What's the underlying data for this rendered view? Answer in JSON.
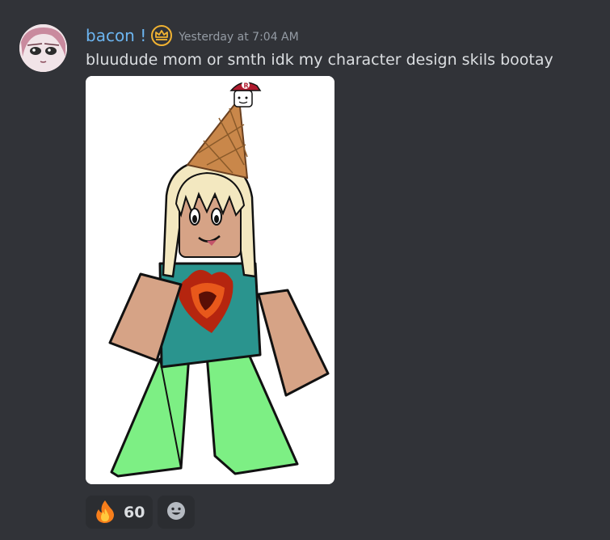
{
  "message": {
    "author": {
      "username": "bacon !",
      "avatar_icon": "anime-avatar-icon",
      "role_icon": "crown-badge-icon",
      "username_color": "#6cb5f0"
    },
    "timestamp": "Yesterday at 7:04 AM",
    "content": "bluudude mom or smth idk my character design skils bootay",
    "attachment": {
      "kind": "image",
      "subject": "character-drawing",
      "hat_letter": "R"
    },
    "reactions": [
      {
        "emoji_icon": "fire-emoji-icon",
        "count": "60"
      }
    ],
    "add_reaction_icon": "smiley-add-reaction-icon"
  },
  "colors": {
    "background": "#313338",
    "text": "#dbdee1",
    "muted": "#949ba4",
    "reaction_bg": "#2b2d31"
  }
}
